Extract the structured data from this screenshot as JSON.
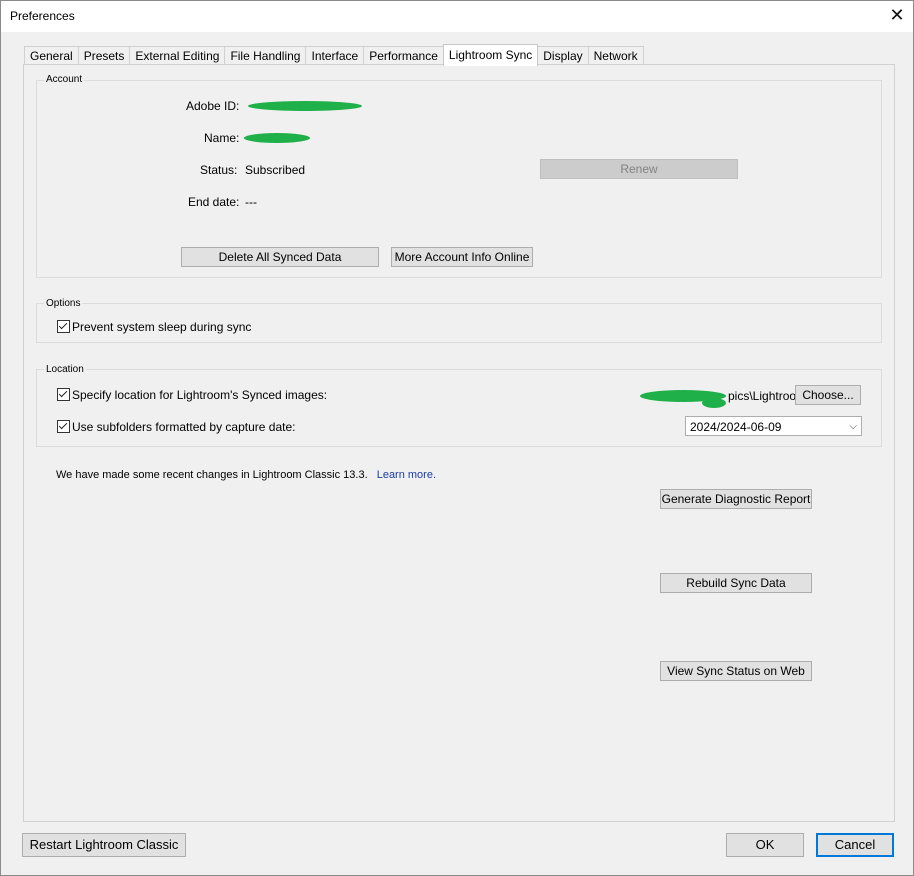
{
  "window": {
    "title": "Preferences"
  },
  "tabs": [
    {
      "label": "General"
    },
    {
      "label": "Presets"
    },
    {
      "label": "External Editing"
    },
    {
      "label": "File Handling"
    },
    {
      "label": "Interface"
    },
    {
      "label": "Performance"
    },
    {
      "label": "Lightroom Sync",
      "active": true
    },
    {
      "label": "Display"
    },
    {
      "label": "Network"
    }
  ],
  "account": {
    "group_title": "Account",
    "adobe_id_label": "Adobe ID:",
    "name_label": "Name:",
    "status_label": "Status:",
    "status_value": "Subscribed",
    "end_date_label": "End date:",
    "end_date_value": "---",
    "renew_label": "Renew",
    "delete_label": "Delete All Synced Data",
    "more_info_label": "More Account Info Online"
  },
  "options": {
    "group_title": "Options",
    "prevent_sleep_label": "Prevent system sleep during sync",
    "prevent_sleep_checked": true
  },
  "location": {
    "group_title": "Location",
    "specify_label": "Specify location for Lightroom's Synced images:",
    "specify_checked": true,
    "path_visible": "pics\\Lightroom",
    "choose_label": "Choose...",
    "subfolders_label": "Use subfolders formatted by capture date:",
    "subfolders_checked": true,
    "subfolder_format": "2024/2024-06-09"
  },
  "notice": {
    "text": "We have made some recent changes in Lightroom Classic 13.3.",
    "link": "Learn more."
  },
  "actions": {
    "diagnostic_label": "Generate Diagnostic Report",
    "rebuild_label": "Rebuild Sync Data",
    "view_status_label": "View Sync Status on Web"
  },
  "footer": {
    "restart_label": "Restart Lightroom Classic",
    "ok_label": "OK",
    "cancel_label": "Cancel"
  }
}
